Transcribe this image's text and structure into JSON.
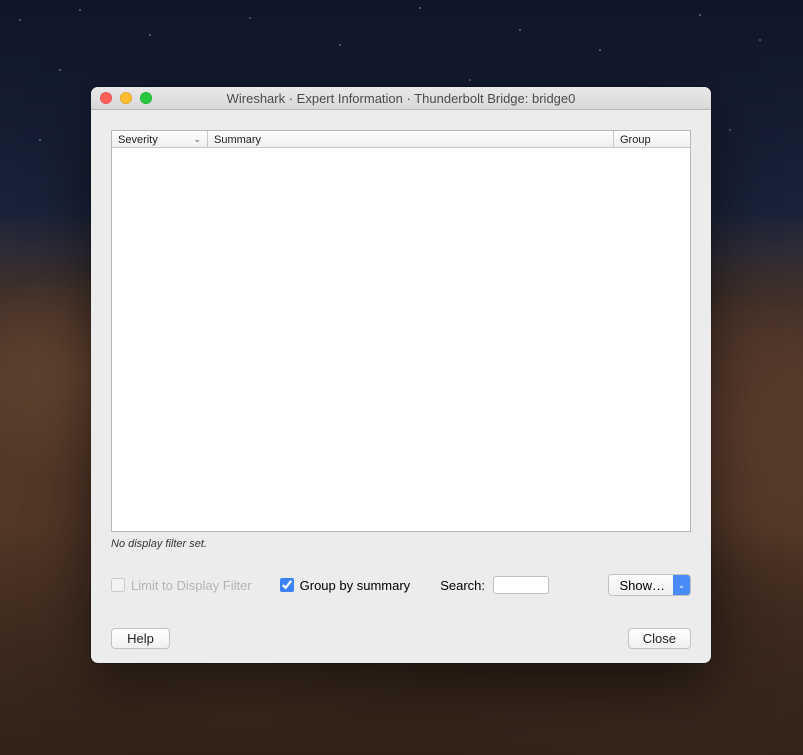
{
  "window": {
    "title": "Wireshark · Expert Information · Thunderbolt Bridge: bridge0"
  },
  "table": {
    "columns": {
      "severity": "Severity",
      "summary": "Summary",
      "group": "Group"
    },
    "rows": []
  },
  "status": "No display filter set.",
  "controls": {
    "limit_label": "Limit to Display Filter",
    "limit_checked": false,
    "group_label": "Group by summary",
    "group_checked": true,
    "search_label": "Search:",
    "search_value": "",
    "show_label": "Show…"
  },
  "buttons": {
    "help": "Help",
    "close": "Close"
  }
}
